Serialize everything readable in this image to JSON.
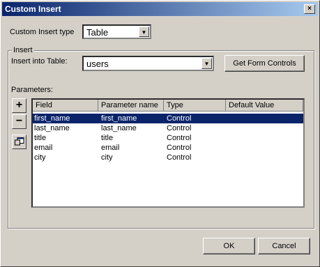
{
  "window": {
    "title": "Custom Insert"
  },
  "insert_type": {
    "label": "Custom Insert type",
    "value": "Table"
  },
  "group": {
    "title": "Insert"
  },
  "insert_into": {
    "label": "Insert into Table:",
    "value": "users"
  },
  "buttons": {
    "get_form_controls": "Get Form Controls",
    "ok": "OK",
    "cancel": "Cancel"
  },
  "parameters": {
    "label": "Parameters:",
    "columns": [
      "Field",
      "Parameter name",
      "Type",
      "Default Value"
    ],
    "rows": [
      [
        "first_name",
        "first_name",
        "Control",
        ""
      ],
      [
        "last_name",
        "last_name",
        "Control",
        ""
      ],
      [
        "title",
        "title",
        "Control",
        ""
      ],
      [
        "email",
        "email",
        "Control",
        ""
      ],
      [
        "city",
        "city",
        "Control",
        ""
      ]
    ],
    "selected_row": 0
  },
  "icons": {
    "add": "+",
    "remove": "−",
    "properties": "properties-icon",
    "close": "×"
  }
}
